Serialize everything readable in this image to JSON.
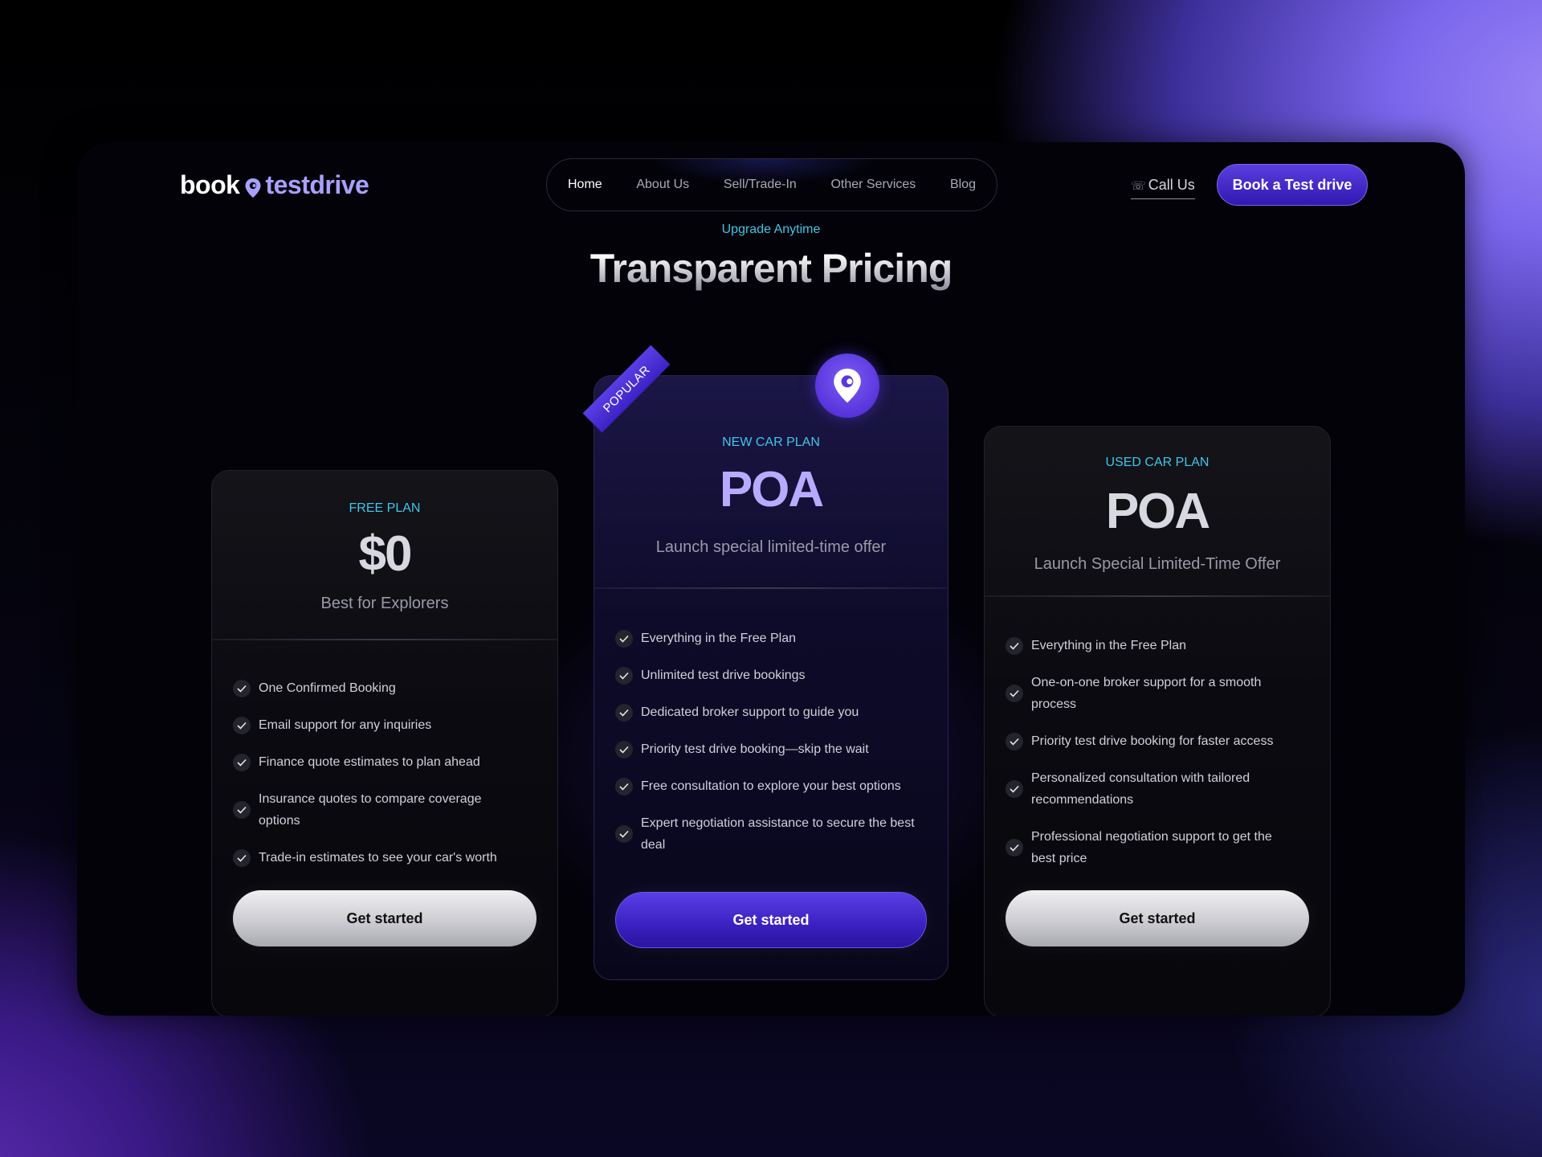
{
  "brand": {
    "word1": "book",
    "word2": "testdrive"
  },
  "nav": {
    "items": [
      "Home",
      "About Us",
      "Sell/Trade-In",
      "Other Services",
      "Blog"
    ],
    "active": "Home"
  },
  "header": {
    "call_us": "Call Us",
    "book_button": "Book a Test drive"
  },
  "hero": {
    "eyebrow": "Upgrade Anytime",
    "title": "Transparent Pricing"
  },
  "plans": [
    {
      "name": "FREE PLAN",
      "price": "$0",
      "subtitle": "Best for Explorers",
      "features": [
        "One Confirmed Booking",
        "Email support for any inquiries",
        "Finance quote estimates to plan ahead",
        "Insurance quotes to compare coverage options",
        "Trade-in estimates to see your car's worth"
      ],
      "cta": "Get started"
    },
    {
      "name": "NEW CAR PLAN",
      "price": "POA",
      "subtitle": "Launch special limited-time offer",
      "badge": "POPULAR",
      "features": [
        "Everything in the Free Plan",
        "Unlimited test drive bookings",
        "Dedicated broker support to guide you",
        "Priority test drive booking—skip the wait",
        "Free consultation to explore your best options",
        "Expert negotiation assistance to secure the best deal"
      ],
      "cta": "Get started"
    },
    {
      "name": "USED CAR PLAN",
      "price": "POA",
      "subtitle": "Launch Special Limited-Time Offer",
      "features": [
        "Everything in the Free Plan",
        "One-on-one broker support for a smooth process",
        "Priority test drive booking for faster access",
        "Personalized consultation with tailored recommendations",
        "Professional negotiation support to get the best price"
      ],
      "cta": "Get started"
    }
  ],
  "colors": {
    "accent": "#4a2ad6",
    "eyebrow": "#3fc6e8",
    "brand_secondary": "#a8a0ff"
  },
  "icons": {
    "logo": "location-pin-icon",
    "call": "phone-icon",
    "check": "check-icon",
    "plan_badge": "location-pin-icon"
  }
}
